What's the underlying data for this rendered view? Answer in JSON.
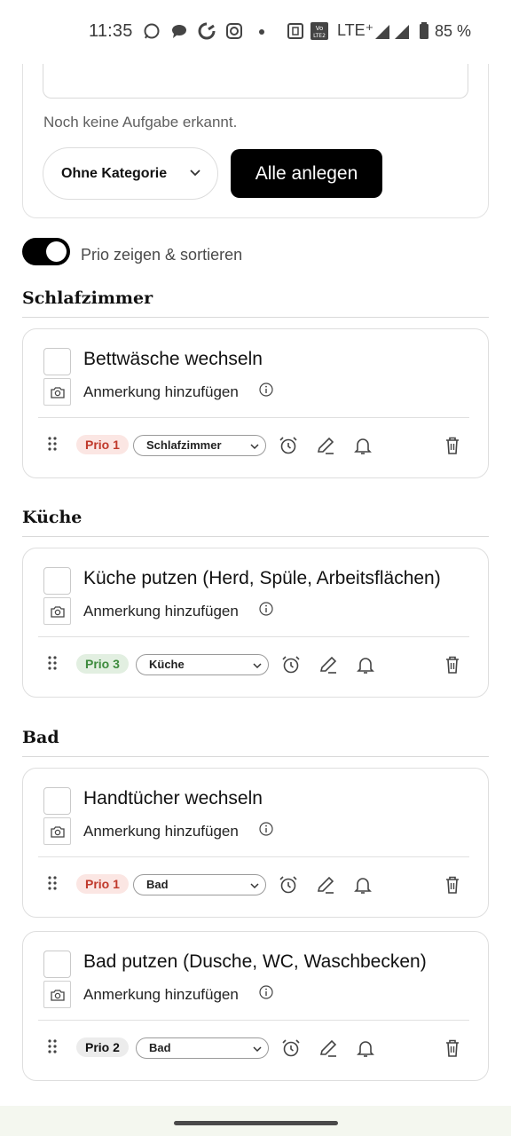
{
  "status_bar": {
    "time": "11:35",
    "network": "LTE⁺",
    "battery": "85 %",
    "icons": [
      "whatsapp-icon",
      "chat-icon",
      "sync-icon",
      "instagram-icon",
      "dot-icon",
      "nfc-icon",
      "volte-icon",
      "signal-icon",
      "signal-icon-2",
      "battery-icon"
    ]
  },
  "input_card": {
    "hint": "Noch keine Aufgabe erkannt.",
    "category_select": "Ohne Kategorie",
    "create_all_button": "Alle anlegen"
  },
  "toggle": {
    "label": "Prio zeigen & sortieren",
    "on": true
  },
  "sections": [
    {
      "title": "Schlafzimmer",
      "tasks": [
        {
          "title": "Bettwäsche wechseln",
          "note": "Anmerkung hinzufügen",
          "prio": "Prio 1",
          "category": "Schlafzimmer"
        }
      ]
    },
    {
      "title": "Küche",
      "tasks": [
        {
          "title": "Küche putzen (Herd, Spüle, Arbeitsflächen)",
          "note": "Anmerkung hinzufügen",
          "prio": "Prio 3",
          "category": "Küche"
        }
      ]
    },
    {
      "title": "Bad",
      "tasks": [
        {
          "title": "Handtücher wechseln",
          "note": "Anmerkung hinzufügen",
          "prio": "Prio 1",
          "category": "Bad"
        },
        {
          "title": "Bad putzen (Dusche, WC, Waschbecken)",
          "note": "Anmerkung hinzufügen",
          "prio": "Prio 2",
          "category": "Bad"
        }
      ]
    }
  ],
  "colors": {
    "prio1_bg": "#fbe6e3",
    "prio1_text": "#c0392b",
    "prio2_bg": "#ececec",
    "prio3_bg": "#e2efe1",
    "prio3_text": "#3d8b3d",
    "primary_button": "#000000"
  }
}
